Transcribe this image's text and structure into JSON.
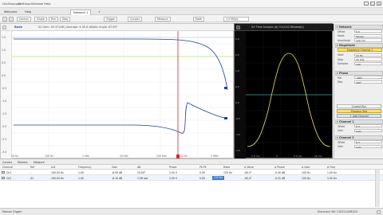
{
  "app": {
    "menus": [
      "Oscilloscope",
      "Settings",
      "Window",
      "Help"
    ],
    "window_controls": [
      "–",
      "□",
      "×"
    ]
  },
  "tabs": {
    "first": "Welcome",
    "second": "Help",
    "active": "Network 1",
    "add": "+"
  },
  "toolbar": {
    "buttons": [
      "Control",
      "Single",
      "Run",
      "Stop",
      "Trigger",
      "Cursors",
      "Measure",
      "Math"
    ],
    "sample_field": "1.5 MSa/s"
  },
  "left_plot": {
    "title": "Bode",
    "info": "A2   Gain: 49.371dB | Average: 4.3E-8 dB/dec  Angle: 67.89°",
    "y_ticks": [
      "1.5",
      "1.0",
      "0.5",
      "0.0",
      "-0.5",
      "-1.0",
      "-1.5",
      "-2.0",
      "-2.5",
      "-3.0"
    ],
    "x_ticks": [
      "10 Hz",
      "100 Hz",
      "1 kHz",
      "10 kHz",
      "100 kHz",
      "1 MHz"
    ],
    "cursor_label": "120 Hz",
    "channel_tag_1": "M1",
    "channel_tag_2": "M2"
  },
  "right_plot": {
    "title": "X-Y Time Analysis (b) Ch1/Ch2 Window[s]",
    "y_ticks": [
      "2.0",
      "1.5",
      "1.0",
      "0.5",
      "0.0",
      "-0.5",
      "-1.0",
      "-1.5"
    ],
    "x_ticks": [
      "-5.0 ms",
      "0",
      "5.0 ms",
      "10 ms"
    ]
  },
  "sidebar": {
    "sections": {
      "network": "Network",
      "magnitude": "Magnitude",
      "phase": "Phase",
      "channel1": "Channel 1",
      "channel2": "Channel 2"
    },
    "network_rows": [
      {
        "label": "Offset",
        "value": "0 V"
      },
      {
        "label": "Mode",
        "value": "Sweep"
      },
      {
        "label": "Amplitude",
        "value": "100 mV"
      }
    ],
    "magnitude_btn": "Frequency Channel 1",
    "magnitude_rows": [
      {
        "label": "Start",
        "value": "10 Hz"
      },
      {
        "label": "Stop",
        "value": "20 kHz"
      },
      {
        "label": "Samples",
        "value": "100"
      }
    ],
    "phase_rows": [
      {
        "label": "Min",
        "value": "-180°"
      },
      {
        "label": "Max",
        "value": "180°"
      }
    ],
    "buttons": {
      "current_run": "Current Run",
      "previous_test": "Previous Test",
      "add_channel": "+ Add Channel"
    },
    "ch1_rows": [
      {
        "label": "Offset",
        "value": "0 V"
      },
      {
        "label": "Gain",
        "value": "Auto"
      }
    ],
    "ch2_rows": [
      {
        "label": "Offset",
        "value": "0 V"
      },
      {
        "label": "Gain",
        "value": "Auto"
      }
    ]
  },
  "table": {
    "tabs": [
      "Cursors",
      "Markers",
      "Measure"
    ],
    "headers": [
      "Channel",
      "Ref",
      "A-B",
      "Frequency",
      "Gain",
      "dB",
      "Phase",
      "Pk-Pk",
      "Ratio",
      "Δ Value",
      "Δ Phase",
      "Δ Gain",
      "Δ Freq"
    ],
    "rows": [
      [
        "Ch1",
        "-",
        "100.00 Hz",
        "1.00",
        "-6.09 dB",
        "25.00°",
        "2.00 V",
        "0.00",
        "120 Hz",
        "-60.3°",
        "-0.40 dB",
        "100 Hz",
        "1.00 Hz"
      ],
      [
        "Ch2",
        "A1",
        "100.00 Hz",
        "1.00",
        "-6.10 dB",
        "1.28 rad",
        "2.00 V",
        "0.00",
        "120 Hz",
        "-60.4°",
        "-0.41 dB",
        "100 Hz",
        "1.00 Hz"
      ]
    ]
  },
  "status": {
    "left": "Manual Trigger",
    "right": "Discovery SN: 210321A5B1D3"
  },
  "colors": {
    "trace_blue": "#1f3f8f",
    "cursor_red": "#d92c2c",
    "guide_green": "#9fd34a",
    "xy_yellow": "#e8e07a",
    "xy_cyan": "#6ee7e0"
  }
}
